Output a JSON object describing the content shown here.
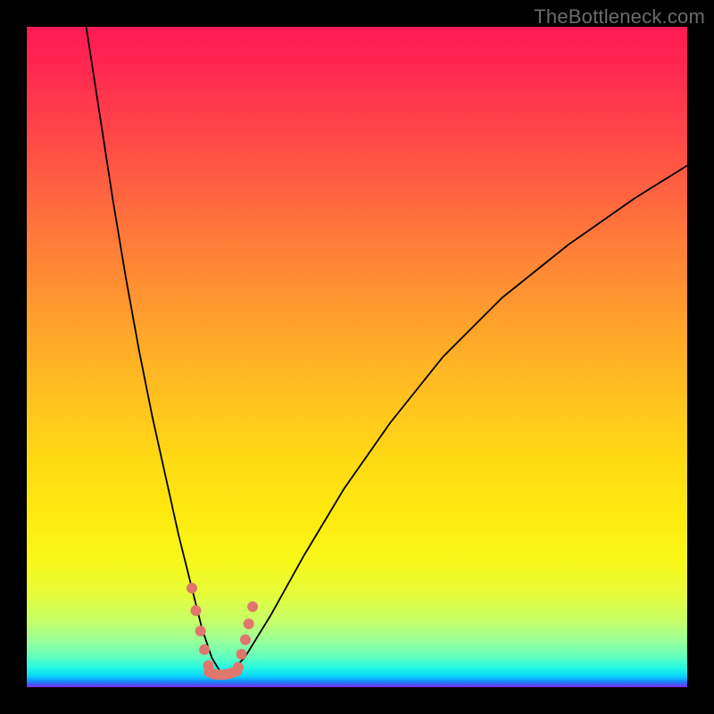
{
  "watermark": "TheBottleneck.com",
  "colors": {
    "frame": "#000000",
    "watermark": "#6b6b6b",
    "curve": "#000000",
    "marker": "#e0766d"
  },
  "chart_data": {
    "type": "line",
    "title": "",
    "xlabel": "",
    "ylabel": "",
    "xlim": [
      0,
      100
    ],
    "ylim": [
      0,
      100
    ],
    "grid": false,
    "legend": false,
    "series": [
      {
        "name": "bottleneck-curve",
        "x": [
          9,
          11,
          13,
          15,
          17,
          19,
          21,
          23,
          25,
          26.5,
          28,
          29.5,
          30.5,
          33,
          37,
          42,
          48,
          55,
          63,
          72,
          82,
          92,
          100
        ],
        "y": [
          100,
          87,
          74,
          62,
          51,
          41,
          32,
          23,
          15,
          9,
          4.5,
          2,
          2,
          4.5,
          11,
          20,
          30,
          40,
          50,
          59,
          67,
          74,
          79
        ]
      }
    ],
    "markers": [
      {
        "name": "left-branch-highlight",
        "x": [
          25.0,
          25.6,
          26.3,
          26.9,
          27.5
        ],
        "y": [
          15.0,
          11.6,
          8.5,
          5.7,
          3.3
        ]
      },
      {
        "name": "valley-highlight",
        "x": [
          27.6,
          28.3,
          29.0,
          29.7,
          30.4,
          31.1,
          31.8
        ],
        "y": [
          2.3,
          2.0,
          1.9,
          1.9,
          2.0,
          2.2,
          2.5
        ]
      },
      {
        "name": "right-branch-highlight",
        "x": [
          32.0,
          32.5,
          33.1,
          33.6,
          34.2
        ],
        "y": [
          3.0,
          5.0,
          7.2,
          9.6,
          12.2
        ]
      }
    ],
    "annotations": []
  }
}
